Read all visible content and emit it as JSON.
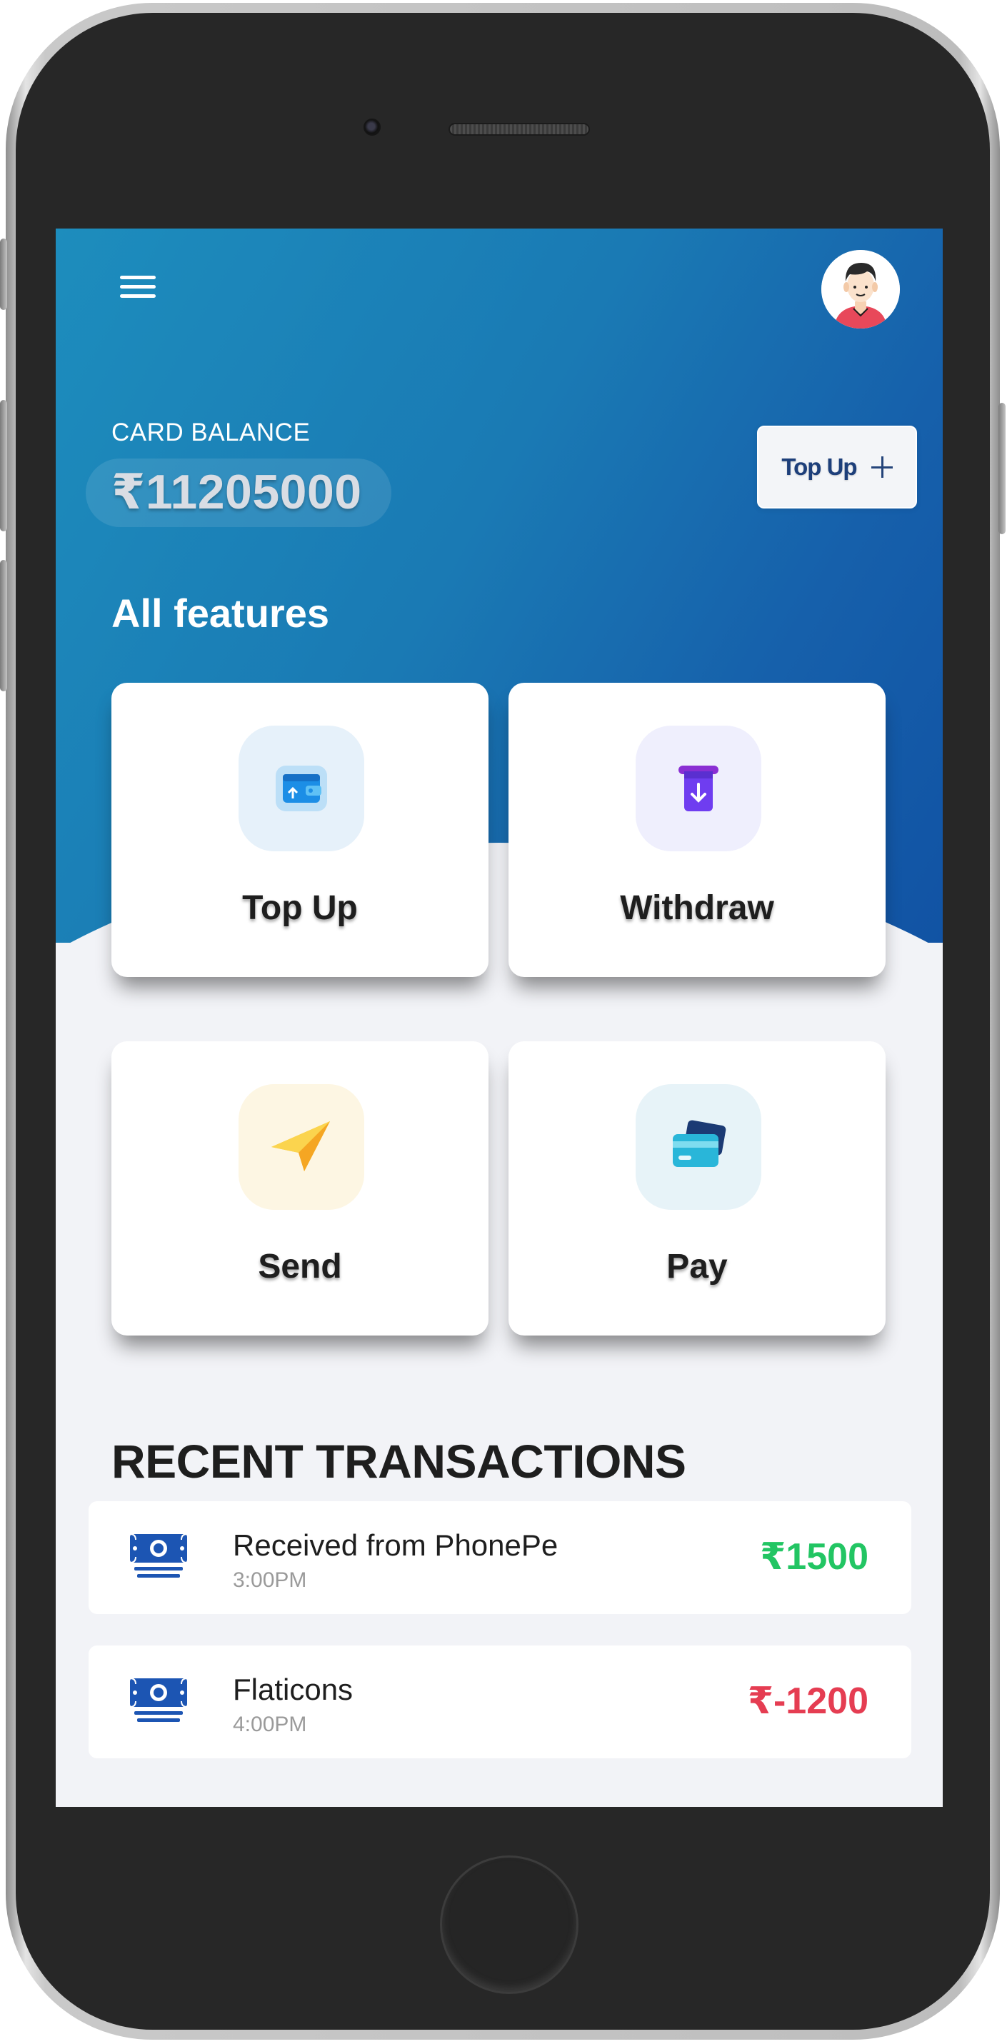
{
  "header": {
    "menu_icon": "hamburger-menu-icon",
    "avatar_icon": "user-avatar-icon"
  },
  "balance": {
    "label": "CARD BALANCE",
    "value": "₹11205000",
    "topup_label": "Top Up",
    "topup_icon": "plus-icon"
  },
  "features": {
    "title": "All features",
    "items": [
      {
        "label": "Top Up",
        "icon": "wallet-topup-icon",
        "icon_bg": "#e6f1fa"
      },
      {
        "label": "Withdraw",
        "icon": "atm-withdraw-icon",
        "icon_bg": "#efeffd"
      },
      {
        "label": "Send",
        "icon": "paper-plane-icon",
        "icon_bg": "#fdf6e3"
      },
      {
        "label": "Pay",
        "icon": "credit-cards-icon",
        "icon_bg": "#e7f3f8"
      }
    ]
  },
  "transactions": {
    "title": "RECENT TRANSACTIONS",
    "items": [
      {
        "name": "Received from PhonePe",
        "time": "3:00PM",
        "amount": "₹1500",
        "amount_color": "#22c563",
        "icon": "money-bills-icon"
      },
      {
        "name": "Flaticons",
        "time": "4:00PM",
        "amount": "₹-1200",
        "amount_color": "#e53d52",
        "icon": "money-bills-icon"
      }
    ]
  },
  "colors": {
    "hero_start": "#1d8dbd",
    "hero_end": "#1153a4",
    "background": "#f2f3f7",
    "positive": "#22c563",
    "negative": "#e53d52"
  }
}
